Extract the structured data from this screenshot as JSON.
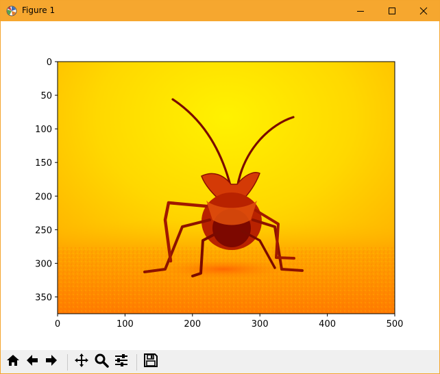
{
  "window": {
    "title": "Figure 1",
    "border_color": "#f5a52d",
    "titlebar_color": "#f6a72f",
    "controls": {
      "minimize_icon": "minimize-icon",
      "maximize_icon": "maximize-icon",
      "close_icon": "close-icon"
    }
  },
  "figure": {
    "image_description_colormap": "hot",
    "x_ticks": [
      "0",
      "100",
      "200",
      "300",
      "400",
      "500"
    ],
    "y_ticks": [
      "0",
      "50",
      "100",
      "150",
      "200",
      "250",
      "300",
      "350"
    ],
    "xlim": [
      0,
      500
    ],
    "ylim": [
      375,
      0
    ]
  },
  "toolbar": {
    "buttons": [
      {
        "name": "home-button",
        "icon": "home-icon"
      },
      {
        "name": "back-button",
        "icon": "arrow-left-icon"
      },
      {
        "name": "forward-button",
        "icon": "arrow-right-icon"
      },
      {
        "name": "pan-button",
        "icon": "move-icon"
      },
      {
        "name": "zoom-button",
        "icon": "magnifier-icon"
      },
      {
        "name": "configure-subplots-button",
        "icon": "sliders-icon"
      },
      {
        "name": "save-button",
        "icon": "floppy-disk-icon"
      }
    ]
  }
}
